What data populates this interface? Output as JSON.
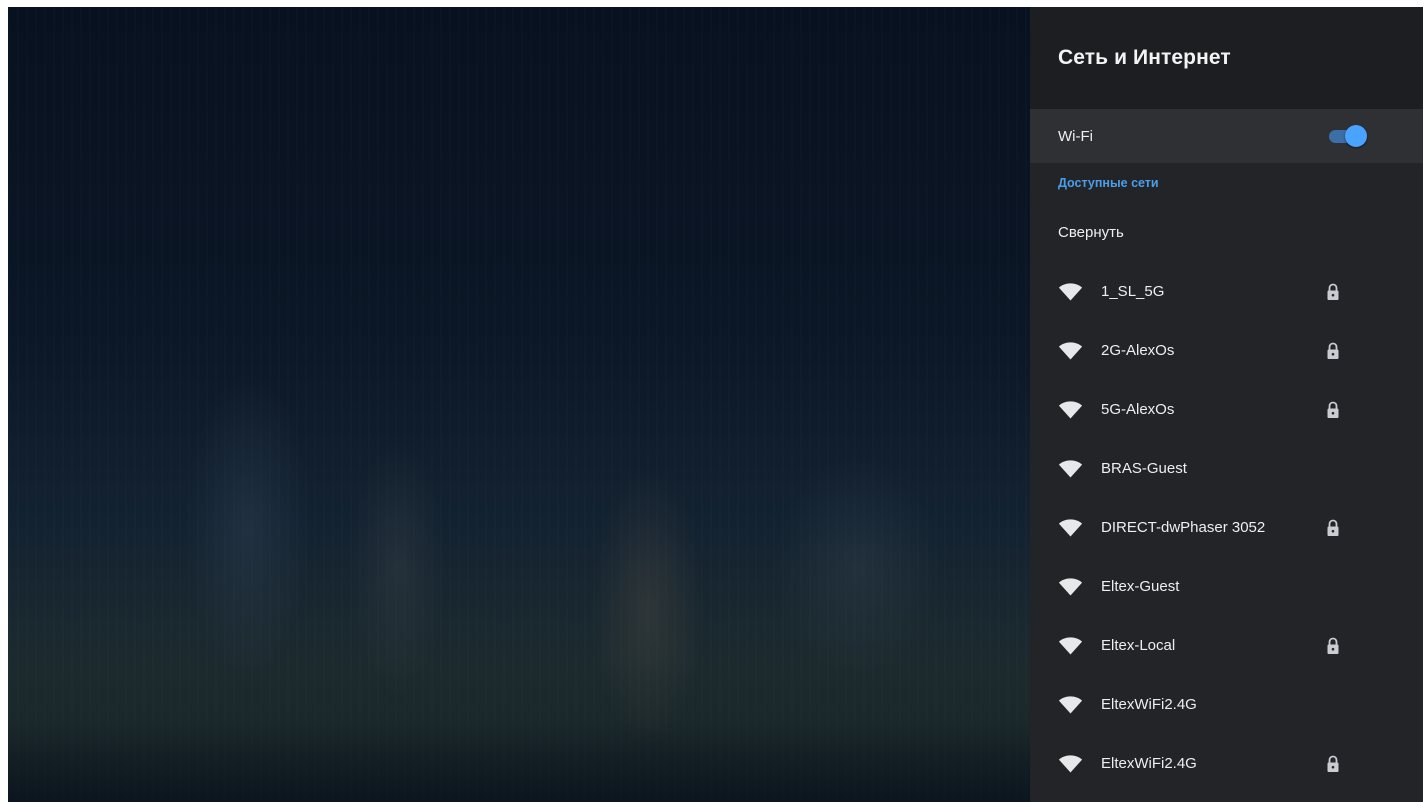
{
  "panel": {
    "title": "Сеть и Интернет",
    "wifi": {
      "label": "Wi-Fi",
      "enabled": true
    },
    "available_label": "Доступные сети",
    "collapse_label": "Свернуть",
    "networks": [
      {
        "name": "1_SL_5G",
        "locked": true
      },
      {
        "name": "2G-AlexOs",
        "locked": true
      },
      {
        "name": "5G-AlexOs",
        "locked": true
      },
      {
        "name": "BRAS-Guest",
        "locked": false
      },
      {
        "name": "DIRECT-dwPhaser 3052",
        "locked": true
      },
      {
        "name": "Eltex-Guest",
        "locked": false
      },
      {
        "name": "Eltex-Local",
        "locked": true
      },
      {
        "name": "EltexWiFi2.4G",
        "locked": false
      },
      {
        "name": "EltexWiFi2.4G",
        "locked": true
      }
    ]
  },
  "colors": {
    "panel_bg": "#232427",
    "header_bg": "#1d1e21",
    "accent": "#4aa3ff",
    "section_label": "#4a9eea"
  },
  "icons": {
    "network": "wifi-signal-icon",
    "secured": "lock-icon"
  }
}
